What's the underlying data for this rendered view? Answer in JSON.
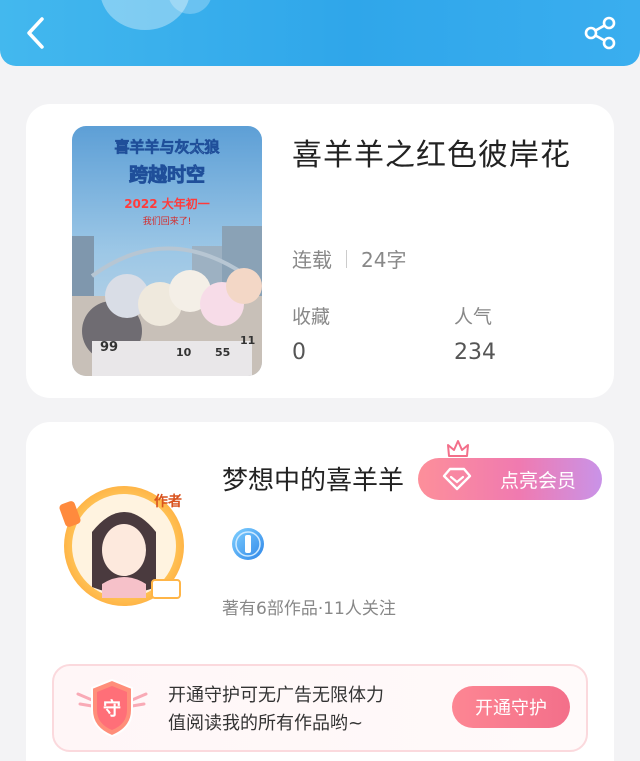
{
  "header": {
    "back_icon": "chevron-left-icon",
    "share_icon": "share-icon",
    "bar_color": "#3aaeef"
  },
  "book": {
    "title": "喜羊羊之红色彼岸花",
    "status": "连载",
    "word_count": "24字",
    "favorites_label": "收藏",
    "favorites_value": "0",
    "popularity_label": "人气",
    "popularity_value": "234",
    "cover_text": {
      "series": "喜羊羊与灰太狼",
      "subtitle": "跨越时空",
      "date": "2022 大年初一",
      "tagline": "我们回来了!"
    }
  },
  "author": {
    "name": "梦想中的喜羊羊",
    "avatar_tag": "作者",
    "vip_label": "点亮会员",
    "works_info": "著有6部作品·11人关注",
    "badge_icon": "level-badge-icon"
  },
  "guard": {
    "shield_text": "守",
    "line1": "开通守护可无广告无限体力",
    "line2": "值阅读我的所有作品哟~",
    "button_label": "开通守护"
  },
  "colors": {
    "accent_pink": "#f36f8a",
    "vip_gradient_end": "#c993e8",
    "background": "#f3f3f5"
  }
}
